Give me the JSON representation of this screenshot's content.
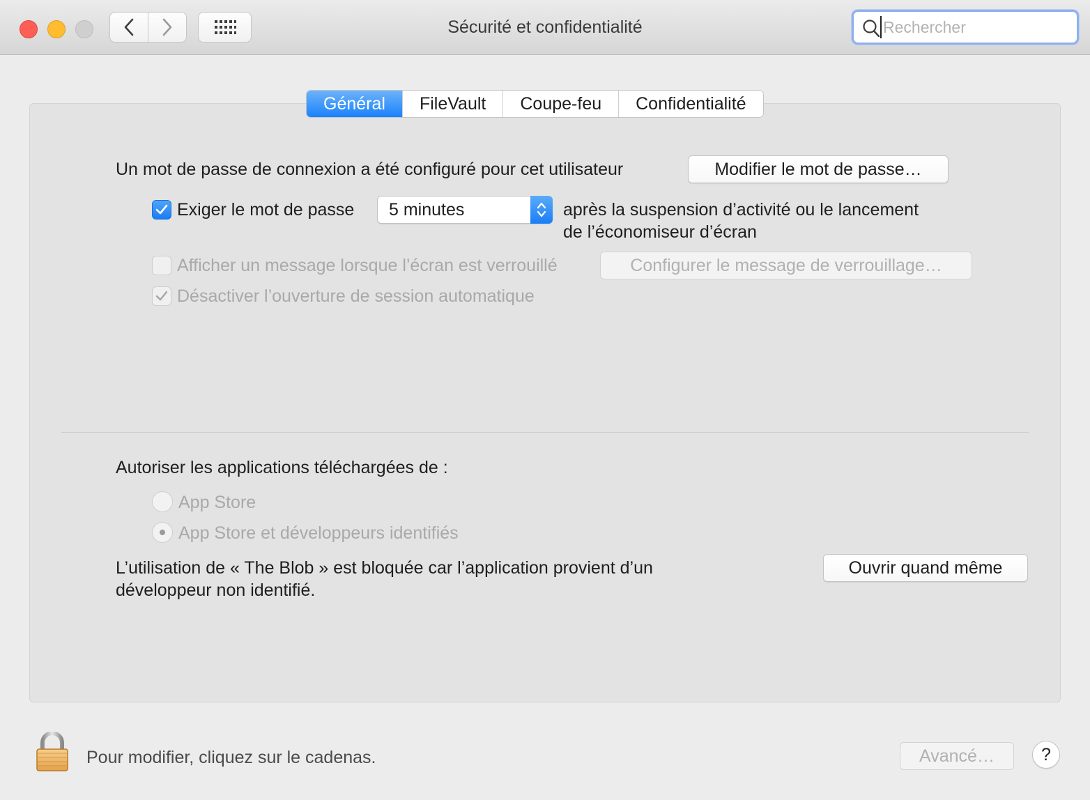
{
  "window": {
    "title": "Sécurité et confidentialité"
  },
  "search": {
    "placeholder": "Rechercher",
    "value": ""
  },
  "tabs": [
    {
      "label": "Général",
      "active": true
    },
    {
      "label": "FileVault",
      "active": false
    },
    {
      "label": "Coupe-feu",
      "active": false
    },
    {
      "label": "Confidentialité",
      "active": false
    }
  ],
  "general": {
    "password_text": "Un mot de passe de connexion a été configuré pour cet utilisateur",
    "change_password_button": "Modifier le mot de passe…",
    "require_password": {
      "label": "Exiger le mot de passe",
      "checked": true
    },
    "delay_select": {
      "value": "5 minutes"
    },
    "after_text_line1": "après la suspension d’activité ou le lancement",
    "after_text_line2": "de l’économiseur d’écran",
    "show_message": {
      "label": "Afficher un message lorsque l’écran est verrouillé",
      "checked": false,
      "enabled": false
    },
    "configure_message_button": "Configurer le message de verrouillage…",
    "disable_auto_login": {
      "label": "Désactiver l’ouverture de session automatique",
      "checked": true,
      "enabled": false
    }
  },
  "downloads": {
    "heading": "Autoriser les applications téléchargées de :",
    "options": [
      {
        "label": "App Store",
        "selected": false
      },
      {
        "label": "App Store et développeurs identifiés",
        "selected": true
      }
    ],
    "blocked_line1": "L’utilisation de « The Blob » est bloquée car l’application provient d’un",
    "blocked_line2": "développeur non identifié.",
    "open_anyway_button": "Ouvrir quand même"
  },
  "footer": {
    "lock_text": "Pour modifier, cliquez sur le cadenas.",
    "advanced_button": "Avancé…",
    "help_button": "?"
  },
  "colors": {
    "accent": "#1a82fb",
    "traffic_close": "#fd5f57",
    "traffic_min": "#febc2e"
  },
  "icons": [
    "back-chevron-icon",
    "forward-chevron-icon",
    "grid-icon",
    "search-icon",
    "checkmark-icon",
    "updown-arrows-icon",
    "lock-icon"
  ]
}
